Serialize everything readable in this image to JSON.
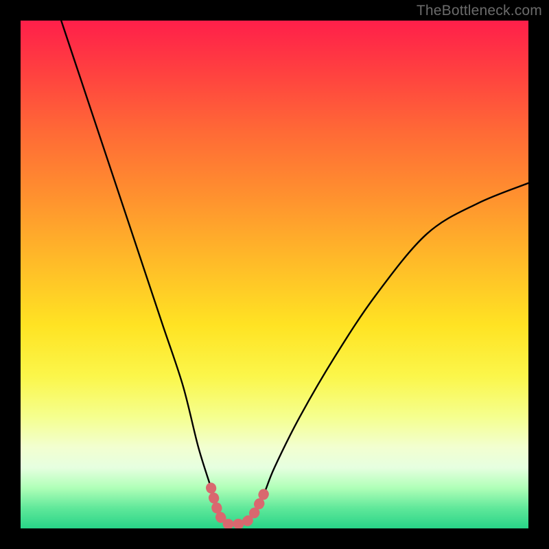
{
  "watermark": "TheBottleneck.com",
  "chart_data": {
    "type": "line",
    "title": "",
    "xlabel": "",
    "ylabel": "",
    "xlim": [
      0,
      100
    ],
    "ylim": [
      0,
      100
    ],
    "series": [
      {
        "name": "curve",
        "color": "#000000",
        "x": [
          8,
          12,
          16,
          20,
          24,
          28,
          32,
          35,
          37.5,
          39,
          40.5,
          42,
          44,
          46,
          48,
          50,
          55,
          62,
          70,
          80,
          90,
          100
        ],
        "y": [
          100,
          88,
          76,
          64,
          52,
          40,
          28,
          16,
          8,
          3,
          1,
          1,
          1,
          3,
          7,
          12,
          22,
          34,
          46,
          58,
          64,
          68
        ]
      },
      {
        "name": "bottom-highlight",
        "color": "#d9686f",
        "x": [
          37.5,
          39,
          40.5,
          42,
          44,
          46,
          48
        ],
        "y": [
          8,
          3,
          1,
          1,
          1,
          3,
          7
        ]
      }
    ],
    "annotations": [],
    "grid": false,
    "legend": false
  }
}
